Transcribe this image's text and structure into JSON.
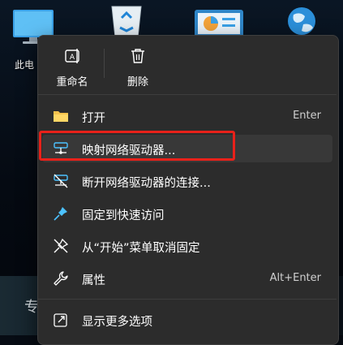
{
  "desktop": {
    "icon_this_pc_label": "此电",
    "bottom_text": "专"
  },
  "toolbar": {
    "rename_label": "重命名",
    "delete_label": "删除"
  },
  "menu": {
    "items": [
      {
        "label": "打开",
        "shortcut": "Enter",
        "icon": "folder-icon"
      },
      {
        "label": "映射网络驱动器...",
        "shortcut": "",
        "icon": "network-drive-icon"
      },
      {
        "label": "断开网络驱动器的连接...",
        "shortcut": "",
        "icon": "disconnect-drive-icon"
      },
      {
        "label": "固定到快速访问",
        "shortcut": "",
        "icon": "pin-icon"
      },
      {
        "label": "从“开始”菜单取消固定",
        "shortcut": "",
        "icon": "unpin-icon"
      },
      {
        "label": "属性",
        "shortcut": "Alt+Enter",
        "icon": "wrench-icon"
      },
      {
        "label": "显示更多选项",
        "shortcut": "",
        "icon": "share-arrow-icon"
      }
    ]
  },
  "colors": {
    "menu_bg": "#2c2c2c",
    "highlight_border": "#e8211a",
    "accent_blue": "#4cc2ff"
  }
}
